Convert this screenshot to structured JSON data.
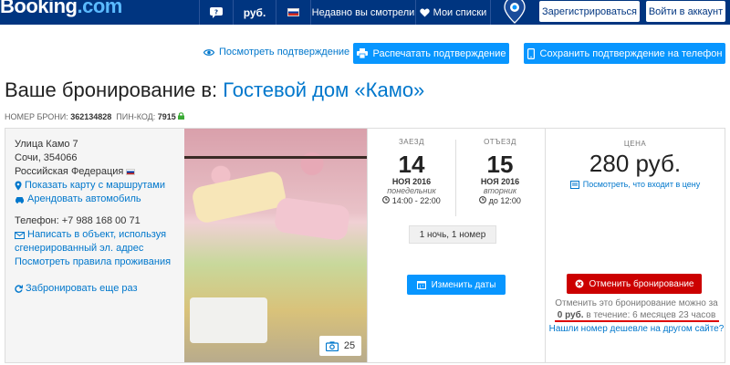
{
  "header": {
    "logo": "Booking",
    "logo_suffix": ".com",
    "currency": "руб.",
    "recent": "Недавно вы смотрели",
    "lists": "Мои списки",
    "register": "Зарегистрироваться",
    "signin": "Войти в аккаунт"
  },
  "actions": {
    "view": "Посмотреть подтверждение",
    "print": "Распечатать подтверждение",
    "save_phone": "Сохранить подтверждение на телефон"
  },
  "booking": {
    "title_prefix": "Ваше бронирование в:",
    "hotel_name": "Гостевой дом «Камо»",
    "conf_label": "НОМЕР БРОНИ:",
    "conf_number": "362134828",
    "pin_label": "ПИН-КОД:",
    "pin": "7915"
  },
  "address": {
    "street": "Улица Камо 7",
    "city": "Сочи, 354066",
    "country": "Российская Федерация",
    "map_link": "Показать карту с маршрутами",
    "car_link": "Арендовать автомобиль",
    "phone": "Телефон: +7 988 168 00 71",
    "write_link_1": "Написать в объект, используя",
    "write_link_2": "сгенерированный эл. адрес",
    "rules_link": "Посмотреть правила проживания",
    "rebook_link": "Забронировать еще раз"
  },
  "photo": {
    "count": "25"
  },
  "dates": {
    "checkin_label": "ЗАЕЗД",
    "checkin_day": "14",
    "checkin_month": "НОЯ 2016",
    "checkin_dow": "понедельник",
    "checkin_time": "14:00 - 22:00",
    "checkout_label": "ОТЪЕЗД",
    "checkout_day": "15",
    "checkout_month": "НОЯ 2016",
    "checkout_dow": "вторник",
    "checkout_time": "до 12:00",
    "nights": "1 ночь, 1 номер",
    "change": "Изменить даты"
  },
  "price": {
    "label": "ЦЕНА",
    "amount": "280 руб.",
    "includes": "Посмотреть, что входит в цену",
    "cancel": "Отменить бронирование",
    "cancel_note_1": "Отменить это бронирование можно за",
    "cancel_note_2a": "0 руб.",
    "cancel_note_2b": "в течение: 6 месяцев 23 часов",
    "cheaper": "Нашли номер дешевле на другом сайте?"
  },
  "colors": {
    "brand": "#003580",
    "button": "#0896ff",
    "danger": "#cc0000",
    "link": "#0077cc"
  }
}
